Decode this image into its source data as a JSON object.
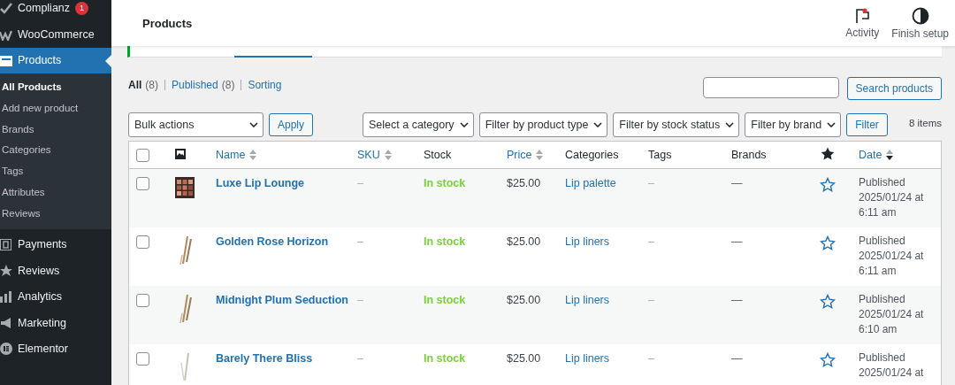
{
  "sidebar": {
    "items": [
      {
        "label": "Complianz",
        "badge": "1",
        "selected": false
      },
      {
        "label": "WooCommerce",
        "selected": false
      },
      {
        "label": "Products",
        "selected": true,
        "children": [
          {
            "label": "All Products",
            "selected": true
          },
          {
            "label": "Add new product",
            "selected": false
          },
          {
            "label": "Brands",
            "selected": false
          },
          {
            "label": "Categories",
            "selected": false
          },
          {
            "label": "Tags",
            "selected": false
          },
          {
            "label": "Attributes",
            "selected": false
          },
          {
            "label": "Reviews",
            "selected": false
          }
        ]
      },
      {
        "label": "Payments",
        "selected": false
      },
      {
        "label": "Reviews",
        "selected": false
      },
      {
        "label": "Analytics",
        "selected": false
      },
      {
        "label": "Marketing",
        "selected": false
      },
      {
        "label": "Elementor",
        "selected": false
      }
    ]
  },
  "header": {
    "title": "Products",
    "actions": [
      {
        "label": "Activity"
      },
      {
        "label": "Finish setup"
      }
    ]
  },
  "views": [
    {
      "label": "All",
      "count": "(8)",
      "selected": true
    },
    {
      "label": "Published",
      "count": "(8)",
      "selected": false
    },
    {
      "label": "Sorting",
      "selected": false
    }
  ],
  "search": {
    "button": "Search products"
  },
  "bulk": {
    "select": "Bulk actions",
    "button": "Apply"
  },
  "filters": [
    "Select a category",
    "Filter by product type",
    "Filter by stock status",
    "Filter by brand"
  ],
  "filter_button": "Filter",
  "item_count": "8 items",
  "table": {
    "columns": [
      {
        "kind": "checkbox",
        "checked": false
      },
      {
        "kind": "image"
      },
      {
        "kind": "sortable",
        "label": "Name",
        "sorted": false
      },
      {
        "kind": "sortable",
        "label": "SKU",
        "sorted": false
      },
      {
        "kind": "plain",
        "label": "Stock"
      },
      {
        "kind": "sortable",
        "label": "Price",
        "sorted": false
      },
      {
        "kind": "plain",
        "label": "Categories"
      },
      {
        "kind": "plain",
        "label": "Tags"
      },
      {
        "kind": "plain",
        "label": "Brands"
      },
      {
        "kind": "featured"
      },
      {
        "kind": "sortable",
        "label": "Date",
        "sorted": true
      }
    ],
    "rows": [
      {
        "kind": "palette",
        "checked": false,
        "name": "Luxe Lip Lounge",
        "sku": "–",
        "stock": "In stock",
        "price": "$25.00",
        "category": "Lip palette",
        "tags": "–",
        "brands": "—",
        "featured": false,
        "date": [
          "Published",
          "2025/01/24 at",
          "6:11 am"
        ]
      },
      {
        "kind": "pencils",
        "checked": false,
        "name": "Golden Rose Horizon",
        "sku": "–",
        "stock": "In stock",
        "price": "$25.00",
        "category": "Lip liners",
        "tags": "–",
        "brands": "—",
        "featured": false,
        "date": [
          "Published",
          "2025/01/24 at",
          "6:11 am"
        ]
      },
      {
        "kind": "pencils",
        "checked": false,
        "name": "Midnight Plum Seduction",
        "sku": "–",
        "stock": "In stock",
        "price": "$25.00",
        "category": "Lip liners",
        "tags": "–",
        "brands": "—",
        "featured": false,
        "date": [
          "Published",
          "2025/01/24 at",
          "6:10 am"
        ]
      },
      {
        "kind": "pencil",
        "checked": false,
        "name": "Barely There Bliss",
        "sku": "–",
        "stock": "In stock",
        "price": "$25.00",
        "category": "Lip liners",
        "tags": "–",
        "brands": "—",
        "featured": false,
        "date": [
          "Published",
          "2025/01/24 at"
        ]
      }
    ]
  }
}
